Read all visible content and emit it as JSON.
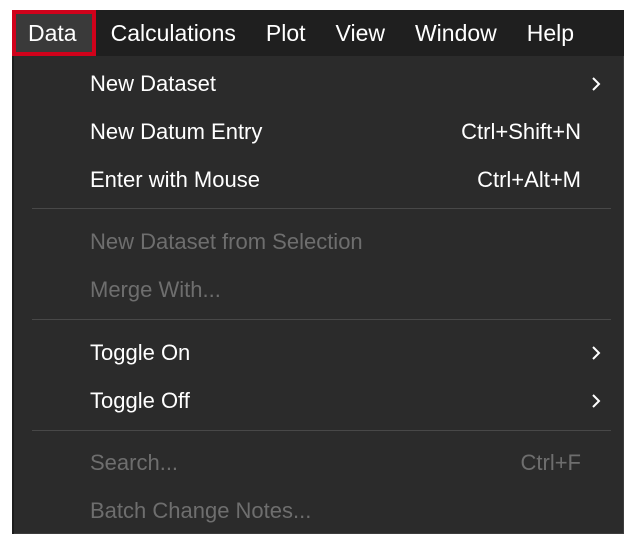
{
  "menubar": {
    "items": [
      {
        "label": "Data"
      },
      {
        "label": "Calculations"
      },
      {
        "label": "Plot"
      },
      {
        "label": "View"
      },
      {
        "label": "Window"
      },
      {
        "label": "Help"
      }
    ],
    "active_index": 0,
    "active_highlight_color": "#d0021b"
  },
  "dropdown": {
    "items": [
      {
        "label": "New Dataset",
        "shortcut": "",
        "submenu": true,
        "enabled": true
      },
      {
        "label": "New Datum Entry",
        "shortcut": "Ctrl+Shift+N",
        "submenu": false,
        "enabled": true
      },
      {
        "label": "Enter with Mouse",
        "shortcut": "Ctrl+Alt+M",
        "submenu": false,
        "enabled": true
      },
      {
        "label": "New Dataset from Selection",
        "shortcut": "",
        "submenu": false,
        "enabled": false
      },
      {
        "label": "Merge With...",
        "shortcut": "",
        "submenu": false,
        "enabled": false
      },
      {
        "label": "Toggle On",
        "shortcut": "",
        "submenu": true,
        "enabled": true
      },
      {
        "label": "Toggle Off",
        "shortcut": "",
        "submenu": true,
        "enabled": true
      },
      {
        "label": "Search...",
        "shortcut": "Ctrl+F",
        "submenu": false,
        "enabled": false
      },
      {
        "label": "Batch Change Notes...",
        "shortcut": "",
        "submenu": false,
        "enabled": false
      }
    ]
  },
  "colors": {
    "menu_background": "#2b2b2b",
    "menubar_background": "#1f1f1f",
    "enabled_text": "#ffffff",
    "disabled_text": "#6e6e6e"
  },
  "icons": {
    "submenu": "chevron-right-icon"
  }
}
